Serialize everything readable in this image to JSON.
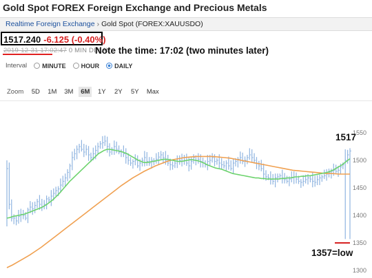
{
  "page_title": "Gold Spot FOREX Foreign Exchange and Precious Metals",
  "breadcrumb": {
    "link": "Realtime Foreign Exchange",
    "separator": "›",
    "current": "Gold Spot (FOREX:XAUUSDO)"
  },
  "quote": {
    "price": "1517.240",
    "change": "-6.125 (-0.40%)",
    "timestamp": "2019-12-31 17:02:47",
    "delay": "0 MIN DELAY"
  },
  "annotations": {
    "time_note": "Note the time: 17:02 (two minutes later)",
    "last_value": "1517",
    "low_value": "1357=low"
  },
  "interval": {
    "label": "Interval",
    "options": [
      "MINUTE",
      "HOUR",
      "DAILY"
    ],
    "selected": "DAILY"
  },
  "zoom": {
    "label": "Zoom",
    "options": [
      "5D",
      "1M",
      "3M",
      "6M",
      "1Y",
      "2Y",
      "5Y",
      "Max"
    ],
    "selected": "6M"
  },
  "colors": {
    "price_bars": "#8fb4e0",
    "ma_short": "#6cd36c",
    "ma_long": "#f0a050",
    "change_red": "#d62020",
    "link_blue": "#1a4f9c"
  },
  "chart_data": {
    "type": "line",
    "y_ticks": [
      "1550",
      "1500",
      "1450",
      "1400",
      "1350",
      "1300"
    ],
    "ylim": [
      1300,
      1560
    ],
    "grid": false,
    "series": [
      {
        "values": [
          1485,
          1420,
          1395,
          1395,
          1390,
          1398,
          1402,
          1400,
          1395,
          1410,
          1415,
          1412,
          1418,
          1425,
          1420,
          1415,
          1420,
          1430,
          1428,
          1435,
          1440,
          1445,
          1448,
          1455,
          1462,
          1468,
          1478,
          1490,
          1505,
          1512,
          1520,
          1525,
          1520,
          1515,
          1520,
          1510,
          1505,
          1512,
          1518,
          1525,
          1530,
          1532,
          1535,
          1525,
          1515,
          1520,
          1525,
          1520,
          1515,
          1515,
          1512,
          1505,
          1500,
          1495,
          1498,
          1500,
          1490,
          1495,
          1500,
          1505,
          1498,
          1495,
          1500,
          1498,
          1502,
          1506,
          1510,
          1505,
          1500,
          1495,
          1492,
          1490,
          1495,
          1498,
          1500,
          1505,
          1500,
          1495,
          1490,
          1498,
          1505,
          1500,
          1502,
          1498,
          1495,
          1492,
          1498,
          1500,
          1505,
          1498,
          1500,
          1495,
          1492,
          1490,
          1495,
          1490,
          1485,
          1495,
          1498,
          1502,
          1505,
          1498,
          1500,
          1505,
          1510,
          1505,
          1500,
          1495,
          1490,
          1485,
          1475,
          1470,
          1468,
          1465,
          1462,
          1468,
          1470,
          1472,
          1468,
          1465,
          1462,
          1466,
          1468,
          1470,
          1466,
          1462,
          1460,
          1462,
          1465,
          1468,
          1466,
          1462,
          1460,
          1465,
          1468,
          1470,
          1472,
          1475,
          1478,
          1480,
          1482,
          1480,
          1482,
          1488,
          1492,
          1500,
          1510,
          1517
        ]
      },
      {
        "values": [
          1395,
          1396,
          1398,
          1399,
          1400,
          1401,
          1402,
          1404,
          1406,
          1408,
          1410,
          1412,
          1414,
          1417,
          1420,
          1424,
          1428,
          1433,
          1438,
          1444,
          1450,
          1456,
          1462,
          1467,
          1472,
          1477,
          1482,
          1487,
          1492,
          1497,
          1502,
          1507,
          1512,
          1515,
          1518,
          1520,
          1520,
          1519,
          1518,
          1517,
          1516,
          1514,
          1512,
          1509,
          1506,
          1503,
          1500,
          1498,
          1496,
          1496,
          1497,
          1498,
          1499,
          1500,
          1501,
          1502,
          1502,
          1501,
          1500,
          1499,
          1498,
          1498,
          1499,
          1500,
          1501,
          1501,
          1500,
          1499,
          1497,
          1495,
          1492,
          1490,
          1488,
          1486,
          1485,
          1484,
          1482,
          1480,
          1478,
          1476,
          1475,
          1474,
          1473,
          1472,
          1471,
          1470,
          1469,
          1468,
          1468,
          1467,
          1467,
          1466,
          1466,
          1466,
          1466,
          1466,
          1467,
          1467,
          1468,
          1468,
          1469,
          1470,
          1470,
          1471,
          1471,
          1472,
          1472,
          1473,
          1474,
          1475,
          1476,
          1477,
          1478,
          1480,
          1482,
          1485,
          1488,
          1491,
          1495,
          1499,
          1503
        ]
      },
      {
        "values": [
          1305,
          1310,
          1316,
          1322,
          1328,
          1335,
          1342,
          1350,
          1358,
          1366,
          1374,
          1382,
          1390,
          1398,
          1406,
          1414,
          1422,
          1430,
          1438,
          1446,
          1454,
          1461,
          1468,
          1474,
          1480,
          1485,
          1490,
          1494,
          1498,
          1501,
          1503,
          1505,
          1506,
          1507,
          1507,
          1507,
          1507,
          1506,
          1505,
          1504,
          1502,
          1500,
          1498,
          1496,
          1494,
          1492,
          1490,
          1488,
          1486,
          1484,
          1482,
          1481,
          1480,
          1479,
          1478,
          1477,
          1476,
          1476,
          1475,
          1475,
          1475
        ]
      }
    ]
  }
}
